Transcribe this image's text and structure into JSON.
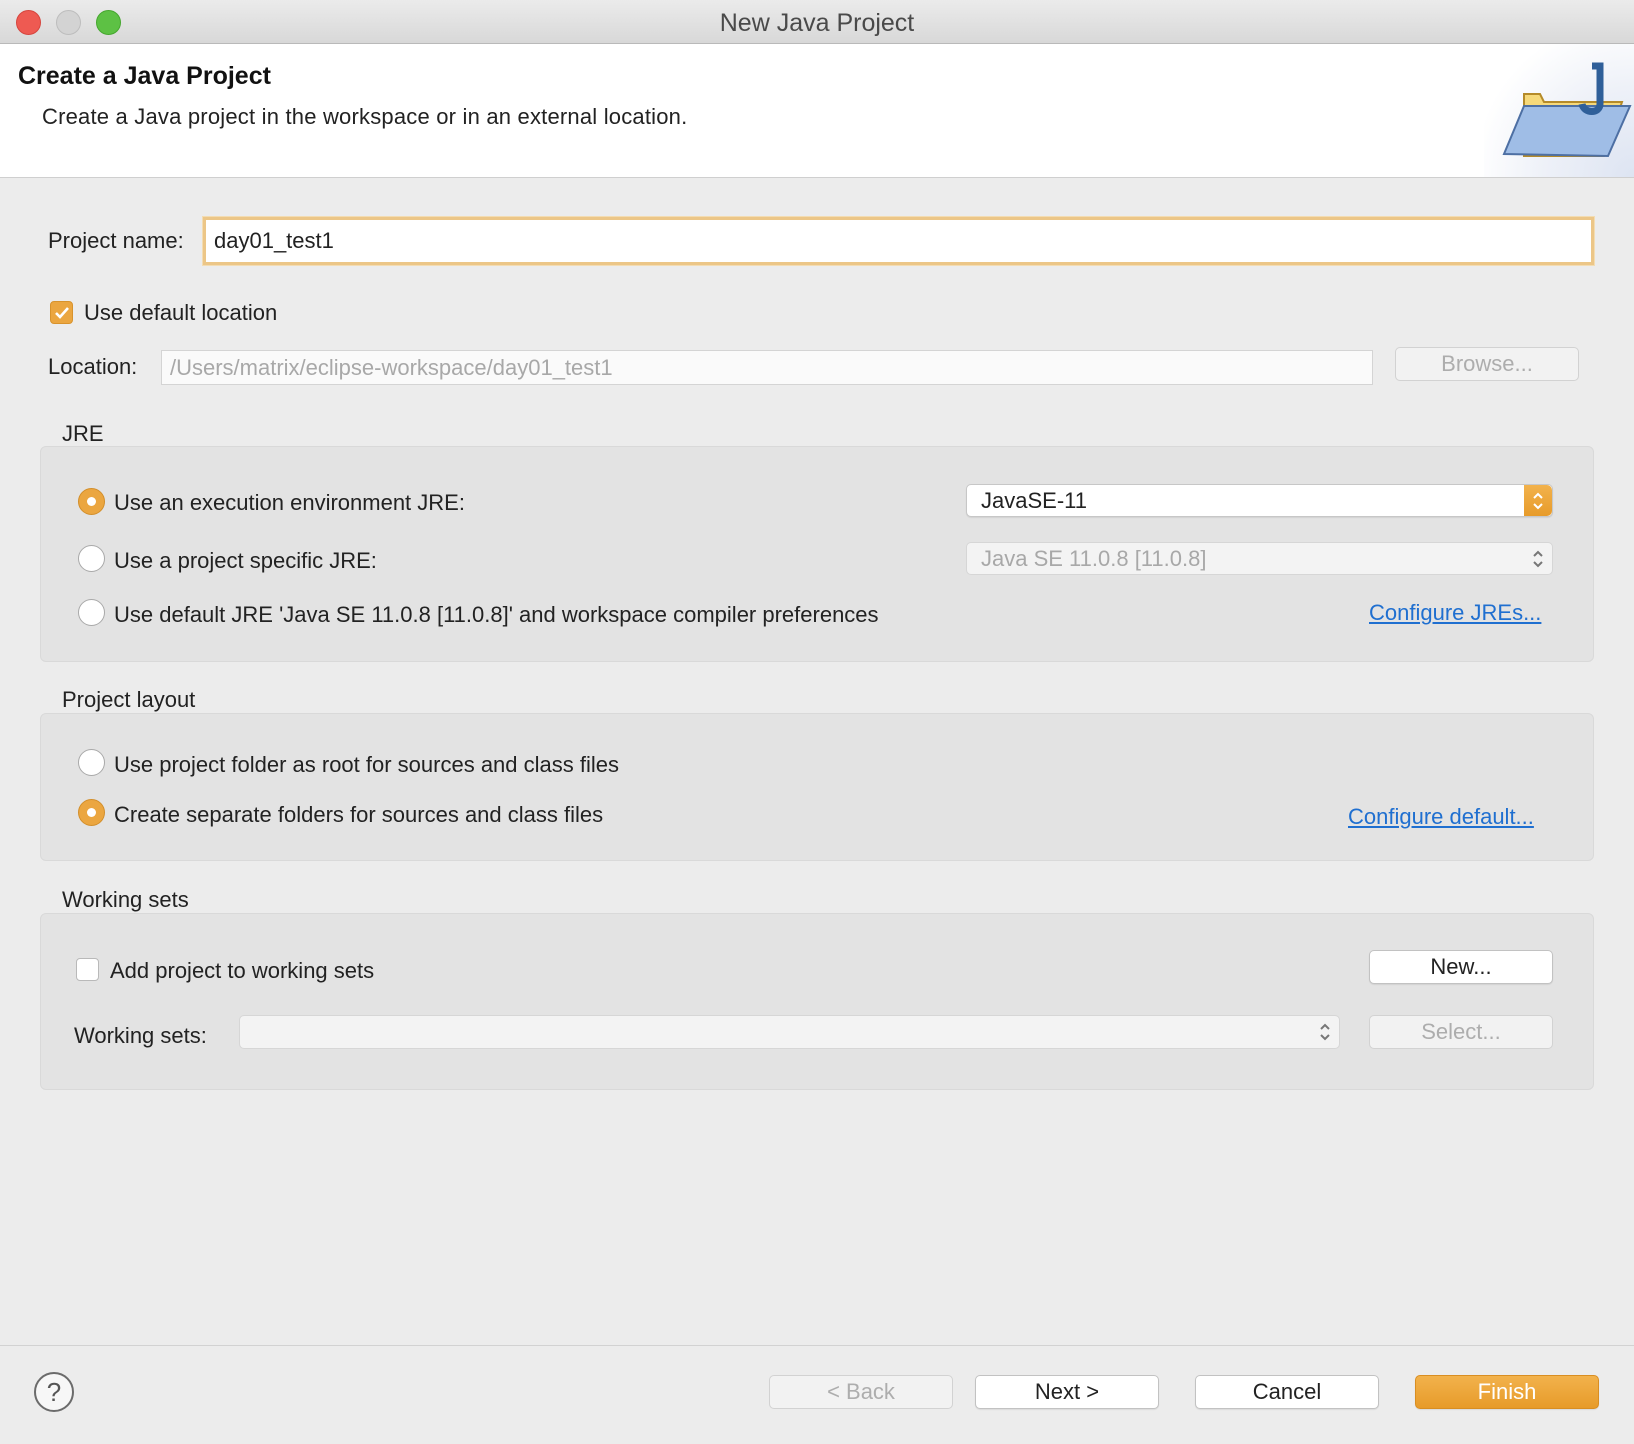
{
  "window": {
    "title": "New Java Project"
  },
  "banner": {
    "title": "Create a Java Project",
    "description": "Create a Java project in the workspace or in an external location."
  },
  "project_name": {
    "label": "Project name:",
    "value": "day01_test1"
  },
  "location": {
    "use_default_label": "Use default location",
    "use_default_checked": true,
    "label": "Location:",
    "value": "/Users/matrix/eclipse-workspace/day01_test1",
    "browse_label": "Browse..."
  },
  "jre": {
    "title": "JRE",
    "options": [
      {
        "label": "Use an execution environment JRE:",
        "selected": true
      },
      {
        "label": "Use a project specific JRE:",
        "selected": false
      },
      {
        "label": "Use default JRE 'Java SE 11.0.8 [11.0.8]' and workspace compiler preferences",
        "selected": false
      }
    ],
    "env_select_value": "JavaSE-11",
    "specific_select_value": "Java SE 11.0.8 [11.0.8]",
    "configure_link": "Configure JREs..."
  },
  "layout": {
    "title": "Project layout",
    "options": [
      {
        "label": "Use project folder as root for sources and class files",
        "selected": false
      },
      {
        "label": "Create separate folders for sources and class files",
        "selected": true
      }
    ],
    "configure_link": "Configure default..."
  },
  "working_sets": {
    "title": "Working sets",
    "add_label": "Add project to working sets",
    "add_checked": false,
    "new_label": "New...",
    "sets_label": "Working sets:",
    "sets_value": "",
    "select_label": "Select..."
  },
  "footer": {
    "help": "?",
    "back": "< Back",
    "next": "Next >",
    "cancel": "Cancel",
    "finish": "Finish"
  },
  "colors": {
    "accent": "#eba640",
    "link": "#1f6fd0"
  }
}
